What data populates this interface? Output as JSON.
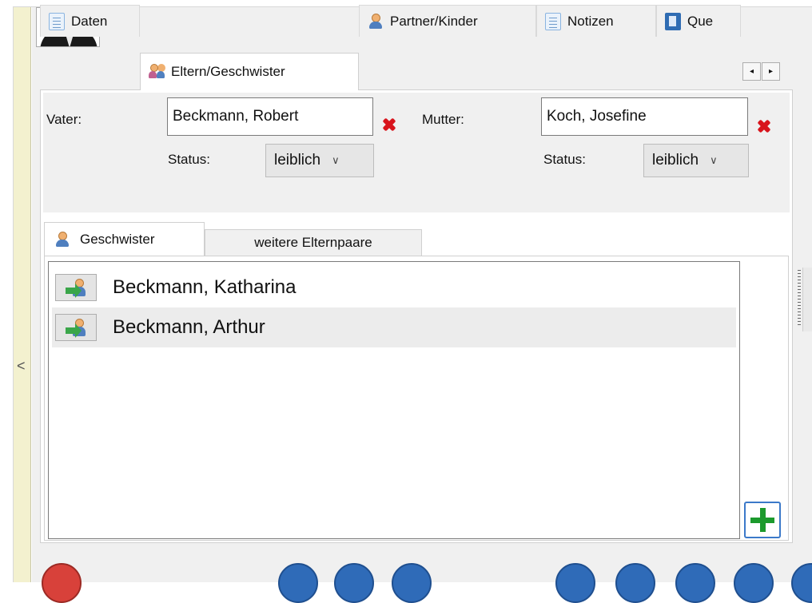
{
  "tabs": [
    {
      "label": "Daten",
      "icon": "document-icon",
      "active": false
    },
    {
      "label": "Eltern/Geschwister",
      "icon": "persons-icon",
      "active": true
    },
    {
      "label": "Partner/Kinder",
      "icon": "person-icon",
      "active": false
    },
    {
      "label": "Notizen",
      "icon": "document-icon",
      "active": false
    },
    {
      "label": "Que",
      "icon": "book-icon",
      "active": false
    }
  ],
  "tab_scroll": {
    "left": "◂",
    "right": "▸"
  },
  "parents": {
    "father_label": "Vater:",
    "father_value": "Beckmann, Robert",
    "father_status_label": "Status:",
    "father_status_value": "leiblich",
    "mother_label": "Mutter:",
    "mother_value": "Koch, Josefine",
    "mother_status_label": "Status:",
    "mother_status_value": "leiblich"
  },
  "subtabs": [
    {
      "label": "Geschwister",
      "active": true
    },
    {
      "label": "weitere Elternpaare",
      "active": false
    }
  ],
  "siblings": [
    {
      "name": "Beckmann, Katharina"
    },
    {
      "name": "Beckmann, Arthur"
    }
  ],
  "colors": {
    "accent": "#3b79c9",
    "delete": "#d8141c",
    "add": "#1c9a2d",
    "sidebar": "#f3f1cf"
  }
}
